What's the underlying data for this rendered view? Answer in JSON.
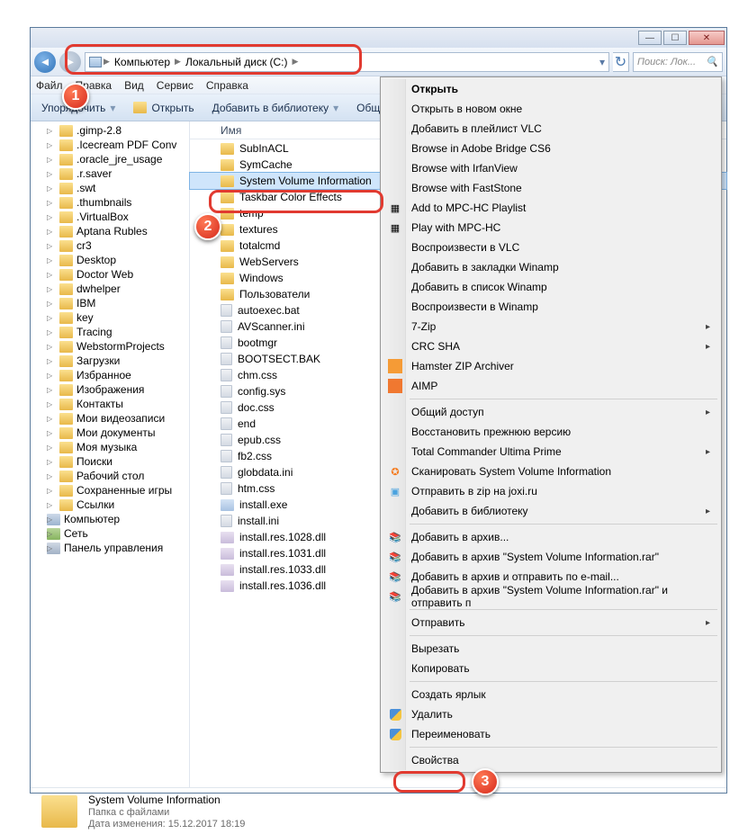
{
  "titlebar": {
    "min": "—",
    "max": "☐",
    "close": "✕"
  },
  "nav": {
    "crumb1": "Компьютер",
    "crumb2": "Локальный диск (C:)",
    "search_placeholder": "Поиск: Лок..."
  },
  "menu": {
    "file": "Файл",
    "edit": "Правка",
    "view": "Вид",
    "tools": "Сервис",
    "help": "Справка"
  },
  "toolbar": {
    "organize": "Упорядочить",
    "open": "Открыть",
    "library": "Добавить в библиотеку",
    "share": "Общий доступ"
  },
  "tree": [
    ".gimp-2.8",
    ".Icecream PDF Conv",
    ".oracle_jre_usage",
    ".r.saver",
    ".swt",
    ".thumbnails",
    ".VirtualBox",
    "Aptana Rubles",
    "cr3",
    "Desktop",
    "Doctor Web",
    "dwhelper",
    "IBM",
    "key",
    "Tracing",
    "WebstormProjects",
    "Загрузки",
    "Избранное",
    "Изображения",
    "Контакты",
    "Мои видеозаписи",
    "Мои документы",
    "Моя музыка",
    "Поиски",
    "Рабочий стол",
    "Сохраненные игры",
    "Ссылки"
  ],
  "tree_special": {
    "computer": "Компьютер",
    "network": "Сеть",
    "cp": "Панель управления"
  },
  "colhdr": "Имя",
  "files_top": [
    "SubInACL",
    "SymCache"
  ],
  "file_selected": "System Volume Information",
  "files_mid": [
    "Taskbar Color Effects",
    "temp",
    "textures",
    "totalcmd",
    "WebServers",
    "Windows",
    "Пользователи"
  ],
  "files_items": [
    {
      "n": "autoexec.bat",
      "t": "file"
    },
    {
      "n": "AVScanner.ini",
      "t": "file"
    },
    {
      "n": "bootmgr",
      "t": "file"
    },
    {
      "n": "BOOTSECT.BAK",
      "t": "file"
    },
    {
      "n": "chm.css",
      "t": "file"
    },
    {
      "n": "config.sys",
      "t": "file"
    },
    {
      "n": "doc.css",
      "t": "file"
    },
    {
      "n": "end",
      "t": "file"
    },
    {
      "n": "epub.css",
      "t": "file"
    },
    {
      "n": "fb2.css",
      "t": "file"
    },
    {
      "n": "globdata.ini",
      "t": "file"
    },
    {
      "n": "htm.css",
      "t": "file"
    },
    {
      "n": "install.exe",
      "t": "exe"
    },
    {
      "n": "install.ini",
      "t": "file"
    },
    {
      "n": "install.res.1028.dll",
      "t": "dll"
    },
    {
      "n": "install.res.1031.dll",
      "t": "dll"
    },
    {
      "n": "install.res.1033.dll",
      "t": "dll"
    },
    {
      "n": "install.res.1036.dll",
      "t": "dll"
    }
  ],
  "ctx": {
    "open": "Открыть",
    "open_new": "Открыть в новом окне",
    "vlc": "Добавить в плейлист VLC",
    "bridge": "Browse in Adobe Bridge CS6",
    "irfan": "Browse with IrfanView",
    "faststone": "Browse with FastStone",
    "mpc_add": "Add to MPC-HC Playlist",
    "mpc_play": "Play with MPC-HC",
    "vlc_play": "Воспроизвести в VLC",
    "winamp_bm": "Добавить в закладки Winamp",
    "winamp_list": "Добавить в список Winamp",
    "winamp_play": "Воспроизвести в Winamp",
    "zip7": "7-Zip",
    "crc": "CRC SHA",
    "hamster": "Hamster ZIP Archiver",
    "aimp": "AIMP",
    "share": "Общий доступ",
    "restore": "Восстановить прежнюю версию",
    "tcup": "Total Commander Ultima Prime",
    "avast": "Сканировать System Volume Information",
    "joxi": "Отправить в zip на joxi.ru",
    "addlib": "Добавить в библиотеку",
    "rar1": "Добавить в архив...",
    "rar2": "Добавить в архив \"System Volume Information.rar\"",
    "rar3": "Добавить в архив и отправить по e-mail...",
    "rar4": "Добавить в архив \"System Volume Information.rar\" и отправить п",
    "send": "Отправить",
    "cut": "Вырезать",
    "copy": "Копировать",
    "shortcut": "Создать ярлык",
    "delete": "Удалить",
    "rename": "Переименовать",
    "props": "Свойства"
  },
  "details": {
    "title": "System Volume Information",
    "type": "Папка с файлами",
    "date_lbl": "Дата изменения:",
    "date": "15.12.2017 18:19"
  },
  "badges": {
    "1": "1",
    "2": "2",
    "3": "3"
  }
}
